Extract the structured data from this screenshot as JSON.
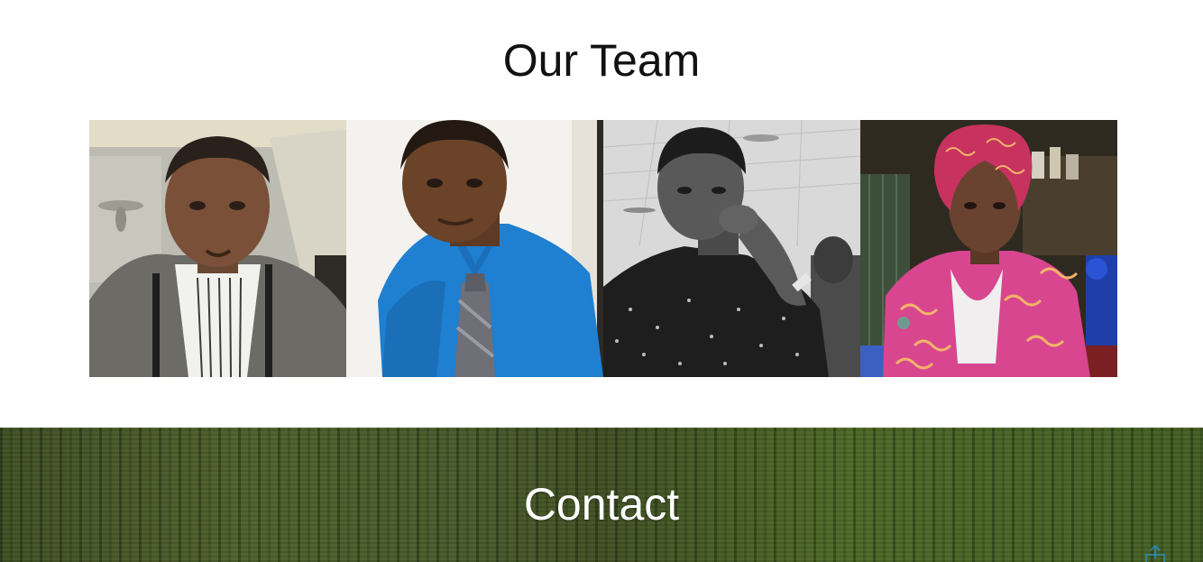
{
  "team": {
    "title": "Our Team",
    "members": [
      {
        "name": "",
        "photo": "man-selfie-grey-jacket"
      },
      {
        "name": "",
        "photo": "man-blue-shirt-tie"
      },
      {
        "name": "",
        "photo": "man-black-white-portrait"
      },
      {
        "name": "",
        "photo": "woman-pink-headwrap"
      }
    ]
  },
  "contact": {
    "title": "Contact",
    "background": "grass-field"
  },
  "icons": {
    "scroll_top": "scroll-to-top-icon"
  },
  "colors": {
    "title_text": "#111111",
    "contact_text": "#ffffff",
    "grass": "#44552a",
    "scroll_icon": "#2a8fb8"
  }
}
